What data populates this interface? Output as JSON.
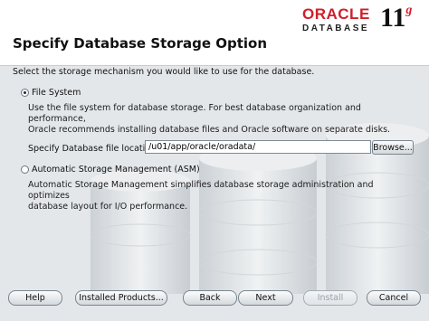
{
  "header": {
    "logo_brand": "ORACLE",
    "logo_product": "DATABASE",
    "logo_version": "11",
    "logo_version_suffix": "g",
    "page_title": "Specify Database Storage Option"
  },
  "main": {
    "intro": "Select the storage mechanism you would like to use for the database.",
    "file_system": {
      "label": "File System",
      "checked": true,
      "description_line1": "Use the file system for database storage.  For best database organization and performance,",
      "description_line2": "Oracle recommends installing database files and Oracle software on separate disks.",
      "field_label": "Specify Database file location:",
      "field_value": "/u01/app/oracle/oradata/",
      "browse_label": "Browse..."
    },
    "asm": {
      "label": "Automatic Storage Management (ASM)",
      "checked": false,
      "description_line1": "Automatic Storage Management simplifies database storage administration and optimizes",
      "description_line2": "database layout for I/O performance."
    }
  },
  "footer": {
    "help": "Help",
    "installed_products": "Installed Products...",
    "back": "Back",
    "next": "Next",
    "install": "Install",
    "cancel": "Cancel"
  },
  "colors": {
    "brand_red": "#d01f2a",
    "background": "#dfe3e6"
  }
}
